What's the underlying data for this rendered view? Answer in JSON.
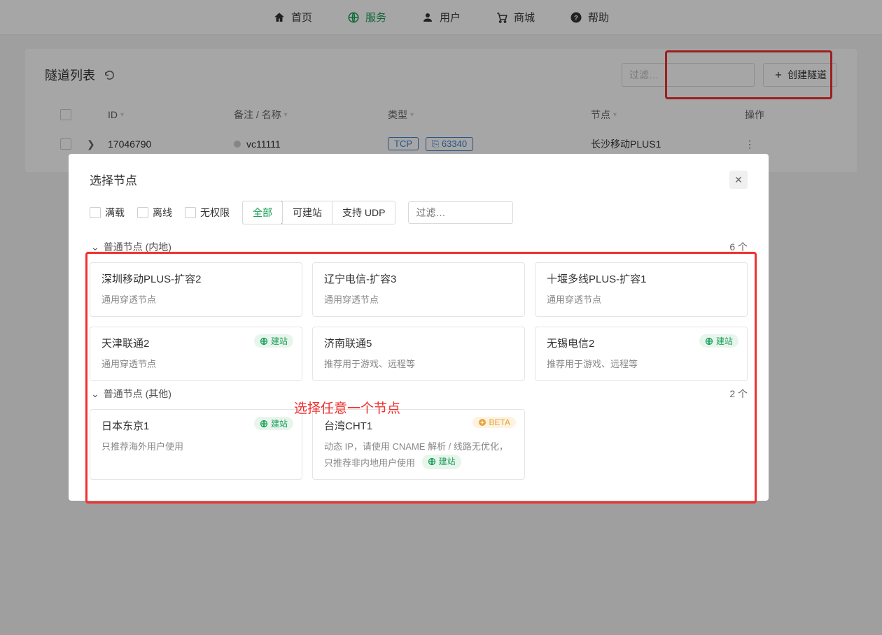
{
  "nav": {
    "home": "首页",
    "service": "服务",
    "user": "用户",
    "shop": "商城",
    "help": "帮助"
  },
  "page": {
    "title": "隧道列表",
    "search_placeholder": "过滤…",
    "create_btn": "创建隧道"
  },
  "table": {
    "headers": {
      "id": "ID",
      "name": "备注 / 名称",
      "type": "类型",
      "node": "节点",
      "action": "操作"
    },
    "rows": [
      {
        "id": "17046790",
        "name": "vc11111",
        "proto": "TCP",
        "port": "63340",
        "node": "长沙移动PLUS1"
      }
    ]
  },
  "modal": {
    "title": "选择节点",
    "filters": {
      "full": "满载",
      "offline": "离线",
      "noperm": "无权限"
    },
    "segments": {
      "all": "全部",
      "cansite": "可建站",
      "udp": "支持 UDP"
    },
    "search_placeholder": "过滤…",
    "groups": [
      {
        "name": "普通节点 (内地)",
        "count": "6 个",
        "nodes": [
          {
            "name": "深圳移动PLUS-扩容2",
            "desc": "通用穿透节点",
            "badge_site": false,
            "badge_beta": false
          },
          {
            "name": "辽宁电信-扩容3",
            "desc": "通用穿透节点",
            "badge_site": false,
            "badge_beta": false
          },
          {
            "name": "十堰多线PLUS-扩容1",
            "desc": "通用穿透节点",
            "badge_site": false,
            "badge_beta": false
          },
          {
            "name": "天津联通2",
            "desc": "通用穿透节点",
            "badge_site": true,
            "badge_beta": false
          },
          {
            "name": "济南联通5",
            "desc": "推荐用于游戏、远程等",
            "badge_site": false,
            "badge_beta": false
          },
          {
            "name": "无锡电信2",
            "desc": "推荐用于游戏、远程等",
            "badge_site": true,
            "badge_beta": false
          }
        ]
      },
      {
        "name": "普通节点 (其他)",
        "count": "2 个",
        "nodes": [
          {
            "name": "日本东京1",
            "desc": "只推荐海外用户使用",
            "badge_site": true,
            "badge_beta": false
          },
          {
            "name": "台湾CHT1",
            "desc": "动态 IP，请使用 CNAME 解析 / 线路无优化，只推荐非内地用户使用",
            "badge_site": true,
            "badge_beta": true,
            "site_inline": true
          }
        ]
      }
    ]
  },
  "badges": {
    "site": "建站",
    "beta": "BETA"
  },
  "annotation": "选择任意一个节点"
}
